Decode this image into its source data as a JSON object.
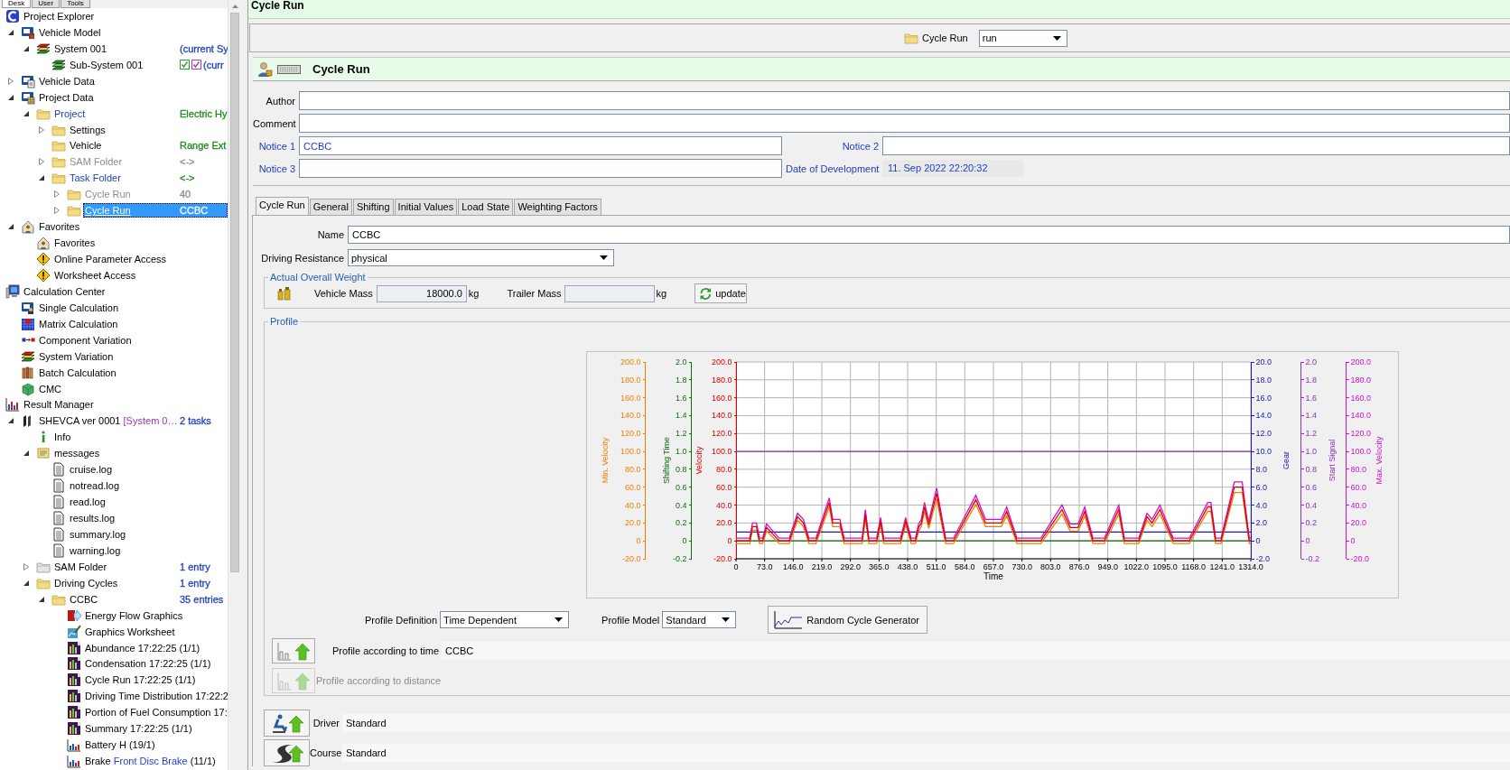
{
  "left_tabs": [
    {
      "label": "Desk",
      "selected": true
    },
    {
      "label": "User",
      "selected": false
    },
    {
      "label": "Tools",
      "selected": false
    }
  ],
  "tree": [
    {
      "label": "Project Explorer",
      "kind": "app",
      "selected": false,
      "children": [
        {
          "label": "Vehicle Model",
          "kind": "model",
          "expanded": true,
          "selected": false,
          "children": [
            {
              "label": "System 001",
              "kind": "system",
              "expanded": true,
              "note": {
                "text": "(current Sy",
                "color": "#1f3fbf"
              },
              "selected": false,
              "children": [
                {
                  "label": "Sub-System 001",
                  "kind": "subsystem",
                  "checks": [
                    {
                      "checked": true,
                      "color": "#2e9e2e"
                    },
                    {
                      "checked": true,
                      "color": "#a040c0"
                    }
                  ],
                  "note": {
                    "text": "(curr",
                    "color": "#1f3fbf"
                  },
                  "selected": false
                }
              ]
            }
          ]
        },
        {
          "label": "Vehicle Data",
          "kind": "data",
          "expanded": false,
          "selected": false
        },
        {
          "label": "Project Data",
          "kind": "project-data",
          "expanded": true,
          "selected": false,
          "children": [
            {
              "label": "Project",
              "kind": "folder",
              "color": "#1f3fbf",
              "expanded": true,
              "note": {
                "text": "Electric Hy",
                "color": "#1e8a1e"
              },
              "selected": false,
              "children": [
                {
                  "label": "Settings",
                  "kind": "folder",
                  "expanded": false,
                  "selected": false
                },
                {
                  "label": "Vehicle",
                  "kind": "folder",
                  "note": {
                    "text": "Range Ext",
                    "color": "#1e8a1e"
                  },
                  "selected": false
                },
                {
                  "label": "SAM Folder",
                  "kind": "folder",
                  "color": "#8c8c8c",
                  "expanded": false,
                  "note": {
                    "text": "<->",
                    "color": "#8c8c8c"
                  },
                  "selected": false
                },
                {
                  "label": "Task Folder",
                  "kind": "folder",
                  "color": "#1f3fbf",
                  "expanded": true,
                  "note": {
                    "text": "<->",
                    "color": "#1e8a1e"
                  },
                  "selected": false,
                  "children": [
                    {
                      "label": "Cycle Run",
                      "kind": "folder",
                      "color": "#8c8c8c",
                      "expanded": false,
                      "note": {
                        "text": "40",
                        "color": "#8c8c8c"
                      },
                      "selected": false
                    },
                    {
                      "label": "Cycle Run",
                      "kind": "folder",
                      "expanded": false,
                      "note": {
                        "text": "CCBC"
                      },
                      "selected": true
                    }
                  ]
                }
              ]
            }
          ]
        },
        {
          "label": "Favorites",
          "kind": "favorites",
          "expanded": true,
          "selected": false,
          "children": [
            {
              "label": "Favorites",
              "kind": "favorites",
              "selected": false
            },
            {
              "label": "Online Parameter Access",
              "kind": "warning",
              "selected": false
            },
            {
              "label": "Worksheet Access",
              "kind": "warning",
              "selected": false
            }
          ]
        }
      ]
    },
    {
      "label": "Calculation Center",
      "kind": "computer",
      "selected": false,
      "children": [
        {
          "label": "Single Calculation",
          "kind": "single",
          "selected": false
        },
        {
          "label": "Matrix Calculation",
          "kind": "matrix",
          "selected": false
        },
        {
          "label": "Component Variation",
          "kind": "variation",
          "selected": false
        },
        {
          "label": "System Variation",
          "kind": "system",
          "selected": false
        },
        {
          "label": "Batch Calculation",
          "kind": "batch",
          "selected": false
        },
        {
          "label": "CMC",
          "kind": "cmc",
          "selected": false
        }
      ]
    },
    {
      "label": "Result Manager",
      "kind": "results",
      "selected": false,
      "children": [
        {
          "label": "SHEVCA ver 0001",
          "kind": "run",
          "detail": {
            "text": "[System 0…",
            "color": "#a030c0"
          },
          "expanded": true,
          "note": {
            "text": "2 tasks",
            "color": "#1f3fbf"
          },
          "selected": false,
          "children": [
            {
              "label": "Info",
              "kind": "info",
              "selected": false
            },
            {
              "label": "messages",
              "kind": "messages",
              "expanded": true,
              "selected": false,
              "children": [
                {
                  "label": "cruise.log",
                  "kind": "log",
                  "selected": false
                },
                {
                  "label": "notread.log",
                  "kind": "log",
                  "selected": false
                },
                {
                  "label": "read.log",
                  "kind": "log",
                  "selected": false
                },
                {
                  "label": "results.log",
                  "kind": "log",
                  "selected": false
                },
                {
                  "label": "summary.log",
                  "kind": "log",
                  "selected": false
                },
                {
                  "label": "warning.log",
                  "kind": "log",
                  "selected": false
                }
              ]
            },
            {
              "label": "SAM Folder",
              "kind": "gray-folder",
              "expanded": false,
              "note": {
                "text": "1 entry",
                "color": "#1f3fbf"
              },
              "selected": false
            },
            {
              "label": "Driving Cycles",
              "kind": "folder",
              "expanded": true,
              "note": {
                "text": "1 entry",
                "color": "#1f3fbf"
              },
              "selected": false,
              "children": [
                {
                  "label": "CCBC",
                  "kind": "folder",
                  "expanded": true,
                  "note": {
                    "text": "35 entries",
                    "color": "#1f3fbf"
                  },
                  "selected": false,
                  "children": [
                    {
                      "label": "Energy Flow Graphics",
                      "kind": "energy",
                      "selected": false
                    },
                    {
                      "label": "Graphics Worksheet",
                      "kind": "worksheet",
                      "selected": false
                    },
                    {
                      "label": "Abundance 17:22:25 (1/1)",
                      "kind": "report",
                      "selected": false
                    },
                    {
                      "label": "Condensation 17:22:25 (1/1)",
                      "kind": "report",
                      "selected": false
                    },
                    {
                      "label": "Cycle Run 17:22:25 (1/1)",
                      "kind": "report",
                      "selected": false
                    },
                    {
                      "label": "Driving Time Distribution 17:22:2",
                      "kind": "report",
                      "selected": false
                    },
                    {
                      "label": "Portion of Fuel Consumption 17:",
                      "kind": "report",
                      "selected": false
                    },
                    {
                      "label": "Summary 17:22:25 (1/1)",
                      "kind": "report",
                      "selected": false
                    },
                    {
                      "label": "Battery H (19/1)",
                      "kind": "bin",
                      "selected": false
                    },
                    {
                      "label": "Brake",
                      "kind": "bin",
                      "detail": {
                        "text": "Front Disc Brake",
                        "color": "#1f3fd0"
                      },
                      "suffix": "(11/1)",
                      "selected": false
                    }
                  ]
                }
              ]
            }
          ]
        }
      ]
    }
  ],
  "title": "Cycle Run",
  "selector": {
    "label": "Cycle Run",
    "value": "run"
  },
  "header": {
    "title": "Cycle Run"
  },
  "form_rows": [
    [
      {
        "label": "Author",
        "emphasis": false
      }
    ],
    [
      {
        "label": "Comment",
        "emphasis": false
      }
    ],
    [
      {
        "label": "Notice 1",
        "emphasis": true,
        "value": "CCBC"
      },
      {
        "label": "Notice 2",
        "emphasis": true
      }
    ],
    [
      {
        "label": "Notice 3",
        "emphasis": true
      },
      {
        "label": "Date of Development",
        "emphasis": true,
        "value": "11. Sep 2022 22:20:32",
        "readonly": true
      }
    ]
  ],
  "tabs": [
    {
      "label": "Cycle Run",
      "selected": true
    },
    {
      "label": "General",
      "selected": false
    },
    {
      "label": "Shifting",
      "selected": false
    },
    {
      "label": "Initial Values",
      "selected": false
    },
    {
      "label": "Load State",
      "selected": false
    },
    {
      "label": "Weighting Factors",
      "selected": false
    }
  ],
  "name_field": {
    "label": "Name",
    "value": "CCBC"
  },
  "resistance_field": {
    "label": "Driving Resistance",
    "value": "physical"
  },
  "weight": {
    "legend": "Actual Overall Weight",
    "fields": [
      {
        "label": "Vehicle Mass",
        "value": "18000.0",
        "unit": "kg"
      },
      {
        "label": "Trailer Mass",
        "unit": "kg"
      }
    ],
    "button": "update"
  },
  "profile": {
    "legend": "Profile",
    "extra_axes": [
      {
        "color": "#f08000",
        "ticks": [
          "200.0",
          "180.0",
          "160.0",
          "140.0",
          "120.0",
          "100.0",
          "80.0",
          "60.0",
          "40.0",
          "20.0",
          "0",
          "-20.0"
        ]
      },
      {
        "color": "#107010",
        "ticks": [
          "2.0",
          "1.8",
          "1.6",
          "1.4",
          "1.2",
          "1.0",
          "0.8",
          "0.6",
          "0.4",
          "0.2",
          "0",
          "-0.2"
        ]
      },
      {
        "color": "#d010d0",
        "ticks": [
          "200.0",
          "180.0",
          "160.0",
          "140.0",
          "120.0",
          "100.0",
          "80.0",
          "60.0",
          "40.0",
          "20.0",
          "0",
          "-20.0"
        ]
      }
    ],
    "chart_data": {
      "type": "line",
      "xlabel": "Time",
      "grid": true,
      "xlim": [
        0,
        1314
      ],
      "ylim": [
        -20,
        200
      ],
      "y2lim": [
        -2,
        20
      ],
      "y3lim": [
        -0.2,
        2
      ],
      "x": [
        0,
        35,
        42,
        52,
        60,
        68,
        78,
        110,
        136,
        157,
        172,
        186,
        204,
        238,
        247,
        265,
        276,
        322,
        330,
        339,
        359,
        369,
        377,
        420,
        433,
        447,
        458,
        466,
        473,
        481,
        492,
        512,
        535,
        555,
        612,
        637,
        677,
        691,
        717,
        778,
        832,
        853,
        873,
        890,
        911,
        940,
        977,
        991,
        1028,
        1049,
        1062,
        1082,
        1116,
        1157,
        1204,
        1212,
        1224,
        1238,
        1272,
        1292,
        1310,
        1314
      ],
      "xticks": [
        {
          "value": 0,
          "label": "0"
        },
        {
          "value": 73,
          "label": "73.0"
        },
        {
          "value": 146,
          "label": "146.0"
        },
        {
          "value": 219,
          "label": "219.0"
        },
        {
          "value": 292,
          "label": "292.0"
        },
        {
          "value": 365,
          "label": "365.0"
        },
        {
          "value": 438,
          "label": "438.0"
        },
        {
          "value": 511,
          "label": "511.0"
        },
        {
          "value": 584,
          "label": "584.0"
        },
        {
          "value": 657,
          "label": "657.0"
        },
        {
          "value": 730,
          "label": "730.0"
        },
        {
          "value": 803,
          "label": "803.0"
        },
        {
          "value": 876,
          "label": "876.0"
        },
        {
          "value": 949,
          "label": "949.0"
        },
        {
          "value": 1022,
          "label": "1022.0"
        },
        {
          "value": 1095,
          "label": "1095.0"
        },
        {
          "value": 1168,
          "label": "1168.0"
        },
        {
          "value": 1241,
          "label": "1241.0"
        },
        {
          "value": 1314,
          "label": "1314.0"
        }
      ],
      "yticks": [
        {
          "value": -20,
          "label": "-20.0"
        },
        {
          "value": 0,
          "label": "0"
        },
        {
          "value": 20,
          "label": "20.0"
        },
        {
          "value": 40,
          "label": "40.0"
        },
        {
          "value": 60,
          "label": "60.0"
        },
        {
          "value": 80,
          "label": "80.0"
        },
        {
          "value": 100,
          "label": "100.0"
        },
        {
          "value": 120,
          "label": "120.0"
        },
        {
          "value": 140,
          "label": "140.0"
        },
        {
          "value": 160,
          "label": "160.0"
        },
        {
          "value": 180,
          "label": "180.0"
        },
        {
          "value": 200,
          "label": "200.0"
        }
      ],
      "y2ticks": [
        {
          "value": -2,
          "label": "-2.0"
        },
        {
          "value": 0,
          "label": "0"
        },
        {
          "value": 2,
          "label": "2.0"
        },
        {
          "value": 4,
          "label": "4.0"
        },
        {
          "value": 6,
          "label": "6.0"
        },
        {
          "value": 8,
          "label": "8.0"
        },
        {
          "value": 10,
          "label": "10.0"
        },
        {
          "value": 12,
          "label": "12.0"
        },
        {
          "value": 14,
          "label": "14.0"
        },
        {
          "value": 16,
          "label": "16.0"
        },
        {
          "value": 18,
          "label": "18.0"
        },
        {
          "value": 20,
          "label": "20.0"
        }
      ],
      "y3ticks": [
        {
          "value": -0.2,
          "label": "-0.2"
        },
        {
          "value": 0,
          "label": "0"
        },
        {
          "value": 0.2,
          "label": "0.2"
        },
        {
          "value": 0.4,
          "label": "0.4"
        },
        {
          "value": 0.6,
          "label": "0.6"
        },
        {
          "value": 0.8,
          "label": "0.8"
        },
        {
          "value": 1,
          "label": "1.0"
        },
        {
          "value": 1.2,
          "label": "1.2"
        },
        {
          "value": 1.4,
          "label": "1.4"
        },
        {
          "value": 1.6,
          "label": "1.6"
        },
        {
          "value": 1.8,
          "label": "1.8"
        },
        {
          "value": 2,
          "label": "2.0"
        }
      ],
      "series": [
        {
          "name": "Gear",
          "color": "#1a1ab0",
          "axis": "y2",
          "values": [
            1,
            1,
            1,
            1,
            1,
            1,
            1,
            1,
            1,
            1,
            1,
            1,
            1,
            1,
            1,
            1,
            1,
            1,
            1,
            1,
            1,
            1,
            1,
            1,
            1,
            1,
            1,
            1,
            1,
            1,
            1,
            1,
            1,
            1,
            1,
            1,
            1,
            1,
            1,
            1,
            1,
            1,
            1,
            1,
            1,
            1,
            1,
            1,
            1,
            1,
            1,
            1,
            1,
            1,
            1,
            1,
            1,
            1,
            1,
            1,
            1,
            1
          ]
        },
        {
          "name": "Start Signal",
          "color": "#9030c0",
          "axis": "y3",
          "values": [
            1,
            1,
            1,
            1,
            1,
            1,
            1,
            1,
            1,
            1,
            1,
            1,
            1,
            1,
            1,
            1,
            1,
            1,
            1,
            1,
            1,
            1,
            1,
            1,
            1,
            1,
            1,
            1,
            1,
            1,
            1,
            1,
            1,
            1,
            1,
            1,
            1,
            1,
            1,
            1,
            1,
            1,
            1,
            1,
            1,
            1,
            1,
            1,
            1,
            1,
            1,
            1,
            1,
            1,
            1,
            1,
            1,
            1,
            1,
            1,
            1,
            1
          ]
        },
        {
          "name": "Shifting Time",
          "color": "#107010",
          "axis": "y3",
          "values": [
            0,
            0,
            0,
            0,
            0,
            0,
            0,
            0,
            0,
            0,
            0,
            0,
            0,
            0,
            0,
            0,
            0,
            0,
            0,
            0,
            0,
            0,
            0,
            0,
            0,
            0,
            0,
            0,
            0,
            0,
            0,
            0,
            0,
            0,
            0,
            0,
            0,
            0,
            0,
            0,
            0,
            0,
            0,
            0,
            0,
            0,
            0,
            0,
            0,
            0,
            0,
            0,
            0,
            0,
            0,
            0,
            0,
            0,
            0,
            0,
            0,
            0
          ]
        },
        {
          "name": "Min. Velocity",
          "color": "#f08000",
          "values": [
            -3,
            -3,
            12,
            12,
            -3,
            -3,
            11,
            -3,
            -3,
            23,
            16,
            -3,
            -3,
            38,
            16,
            16,
            -3,
            -3,
            25,
            -3,
            -3,
            18,
            -3,
            -3,
            18,
            -3,
            -3,
            11,
            16,
            33,
            14,
            47,
            -3,
            -3,
            41,
            16,
            16,
            28,
            -3,
            -3,
            30,
            11,
            11,
            28,
            -3,
            -3,
            30,
            -3,
            -3,
            23,
            16,
            30,
            -3,
            -3,
            33,
            33,
            -3,
            -3,
            54,
            54,
            -3,
            -3
          ]
        },
        {
          "name": "Max. Velocity",
          "color": "#d010d0",
          "values": [
            3,
            3,
            20,
            20,
            3,
            3,
            19,
            3,
            3,
            31,
            24,
            3,
            3,
            48,
            24,
            24,
            3,
            3,
            35,
            3,
            3,
            26,
            3,
            3,
            26,
            3,
            3,
            19,
            24,
            43,
            22,
            59,
            3,
            3,
            51,
            24,
            24,
            38,
            3,
            3,
            40,
            19,
            19,
            38,
            3,
            3,
            40,
            3,
            3,
            31,
            24,
            40,
            3,
            3,
            43,
            43,
            3,
            3,
            66,
            66,
            3,
            3
          ]
        },
        {
          "name": "Velocity",
          "color": "#e00000",
          "values": [
            0,
            0,
            16,
            16,
            0,
            0,
            15,
            0,
            0,
            27,
            20,
            0,
            0,
            43,
            20,
            20,
            0,
            0,
            30,
            0,
            0,
            22,
            0,
            0,
            22,
            0,
            0,
            15,
            20,
            38,
            18,
            53,
            0,
            0,
            46,
            20,
            20,
            33,
            0,
            0,
            35,
            15,
            15,
            33,
            0,
            0,
            35,
            0,
            0,
            27,
            20,
            35,
            0,
            0,
            38,
            38,
            0,
            0,
            60,
            60,
            0,
            0
          ]
        }
      ]
    },
    "definition": {
      "label": "Profile Definition",
      "value": "Time Dependent"
    },
    "model": {
      "label": "Profile Model",
      "value": "Standard"
    },
    "generator_button": "Random Cycle Generator",
    "sources": [
      {
        "label": "Profile according to time",
        "value": "CCBC",
        "disabled": false
      },
      {
        "label": "Profile according to distance",
        "disabled": true
      }
    ]
  },
  "assignments": [
    {
      "kind": "driver",
      "label": "Driver",
      "value": "Standard"
    },
    {
      "kind": "course",
      "label": "Course",
      "value": "Standard"
    }
  ]
}
